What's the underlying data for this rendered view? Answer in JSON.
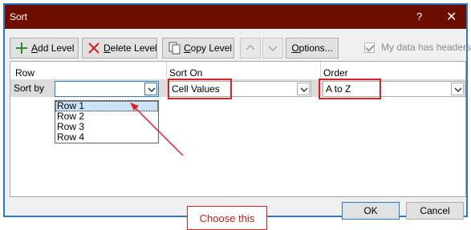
{
  "dialog": {
    "title": "Sort",
    "help_glyph": "?",
    "close_glyph": "✕"
  },
  "toolbar": {
    "add_level": {
      "accel": "A",
      "rest": "dd Level"
    },
    "delete_level": {
      "accel": "D",
      "rest": "elete Level"
    },
    "copy_level": {
      "accel": "C",
      "rest": "opy Level"
    },
    "options": {
      "accel": "O",
      "rest": "ptions..."
    },
    "my_data_has_headers": "My data has headers",
    "my_data_has_headers_checked": true
  },
  "columns": {
    "row": "Row",
    "sort_on": "Sort On",
    "order": "Order"
  },
  "level": {
    "label": "Sort by",
    "row_value": "",
    "sort_on_value": "Cell Values",
    "order_value": "A to Z"
  },
  "dropdown_options": [
    "Row 1",
    "Row 2",
    "Row 3",
    "Row 4"
  ],
  "dropdown_selected_index": 0,
  "annotation": {
    "callout_text": "Choose this",
    "color": "#d42424"
  },
  "footer": {
    "ok": "OK",
    "cancel": "Cancel"
  },
  "colors": {
    "titlebar": "#6e0e00",
    "accent": "#2a7ac8",
    "selection": "#cce4f7"
  }
}
